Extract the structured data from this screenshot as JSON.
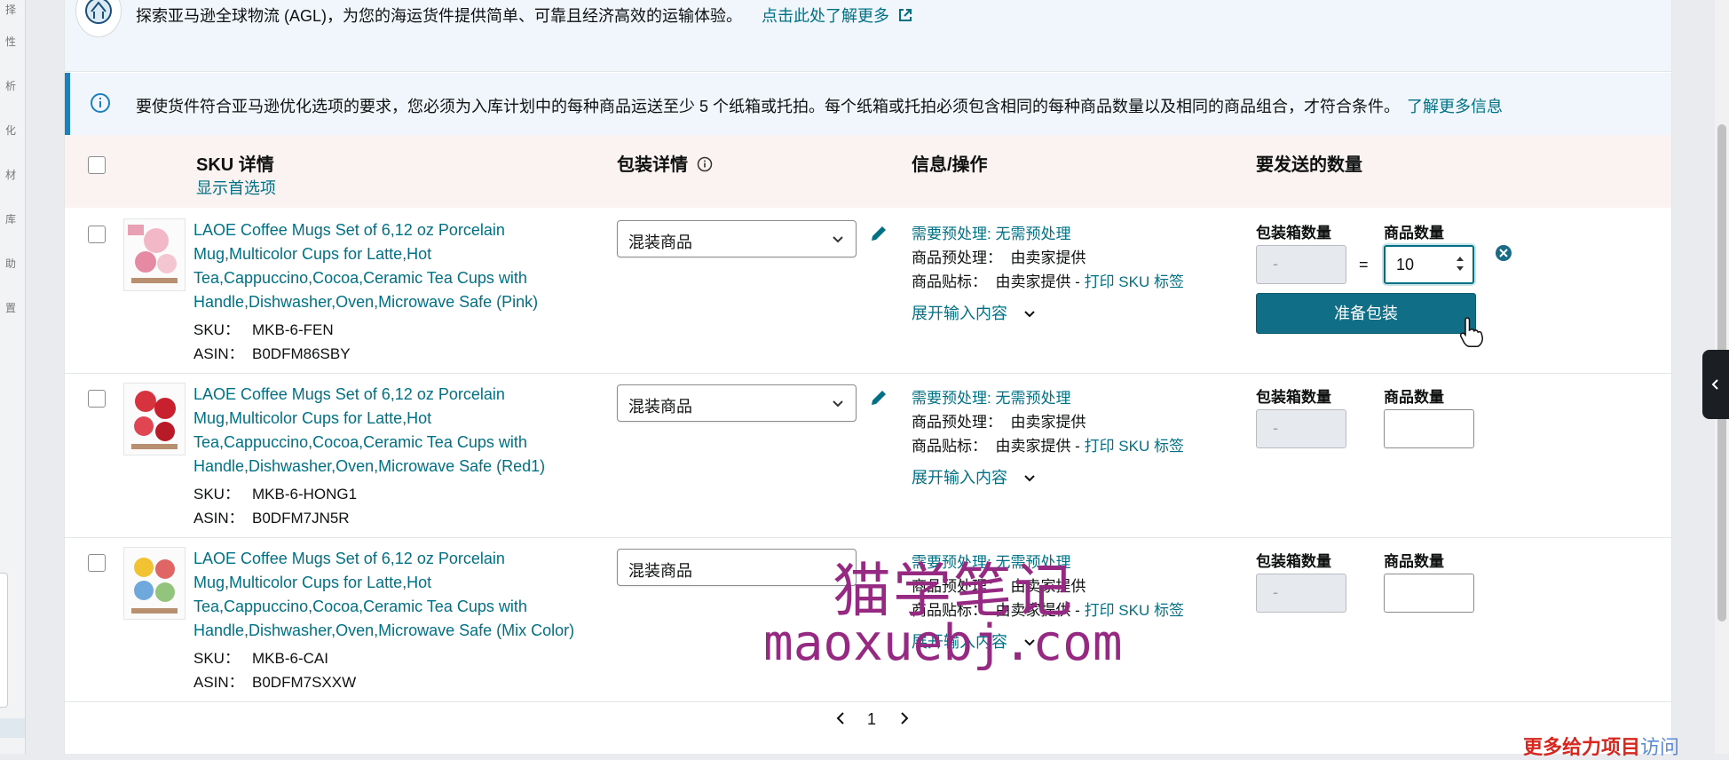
{
  "banner": {
    "text": "探索亚马逊全球物流 (AGL)，为您的海运货件提供简单、可靠且经济高效的运输体验。",
    "link": "点击此处了解更多"
  },
  "alert": {
    "text": "要使货件符合亚马逊优化选项的要求，您必须为入库计划中的每种商品运送至少 5 个纸箱或托拍。每个纸箱或托拍必须包含相同的每种商品数量以及相同的商品组合，才符合条件。",
    "link": "了解更多信息"
  },
  "table": {
    "headers": {
      "sku": "SKU 详情",
      "sku_sub": "显示首选项",
      "packing": "包装详情",
      "info": "信息/操作",
      "qty": "要发送的数量"
    },
    "labels": {
      "sku": "SKU：",
      "asin": "ASIN：",
      "prep_req": "需要预处理: 无需预处理",
      "prep": "商品预处理：",
      "prep_val": "由卖家提供",
      "label": "商品贴标：",
      "label_val": "由卖家提供 -",
      "print": "打印 SKU 标签",
      "expand": "展开输入内容",
      "box_count": "包装箱数量",
      "unit_count": "商品数量",
      "dash": "-",
      "eq": "="
    },
    "rows": [
      {
        "title": "LAOE Coffee Mugs Set of 6,12 oz Porcelain Mug,Multicolor Cups for Latte,Hot Tea,Cappuccino,Cocoa,Ceramic Tea Cups with Handle,Dishwasher,Oven,Microwave Safe (Pink)",
        "sku": "MKB-6-FEN",
        "asin": "B0DFM86SBY",
        "packing": "混装商品",
        "unit_count": "10",
        "prep_button": "准备包装"
      },
      {
        "title": "LAOE Coffee Mugs Set of 6,12 oz Porcelain Mug,Multicolor Cups for Latte,Hot Tea,Cappuccino,Cocoa,Ceramic Tea Cups with Handle,Dishwasher,Oven,Microwave Safe (Red1)",
        "sku": "MKB-6-HONG1",
        "asin": "B0DFM7JN5R",
        "packing": "混装商品",
        "unit_count": ""
      },
      {
        "title": "LAOE Coffee Mugs Set of 6,12 oz Porcelain Mug,Multicolor Cups for Latte,Hot Tea,Cappuccino,Cocoa,Ceramic Tea Cups with Handle,Dishwasher,Oven,Microwave Safe (Mix Color)",
        "sku": "MKB-6-CAI",
        "asin": "B0DFM7SXXW",
        "packing": "混装商品",
        "unit_count": ""
      }
    ]
  },
  "pager": {
    "current": "1"
  },
  "watermark": {
    "cn": "猫学笔记",
    "url": "maoxuebj.com"
  },
  "promo": {
    "red": "更多给力项目",
    "blue": "访问"
  },
  "colors": {
    "link": "#007185",
    "button": "#106e86",
    "alert_bar": "#1e7fbf",
    "watermark": "#962a83"
  }
}
